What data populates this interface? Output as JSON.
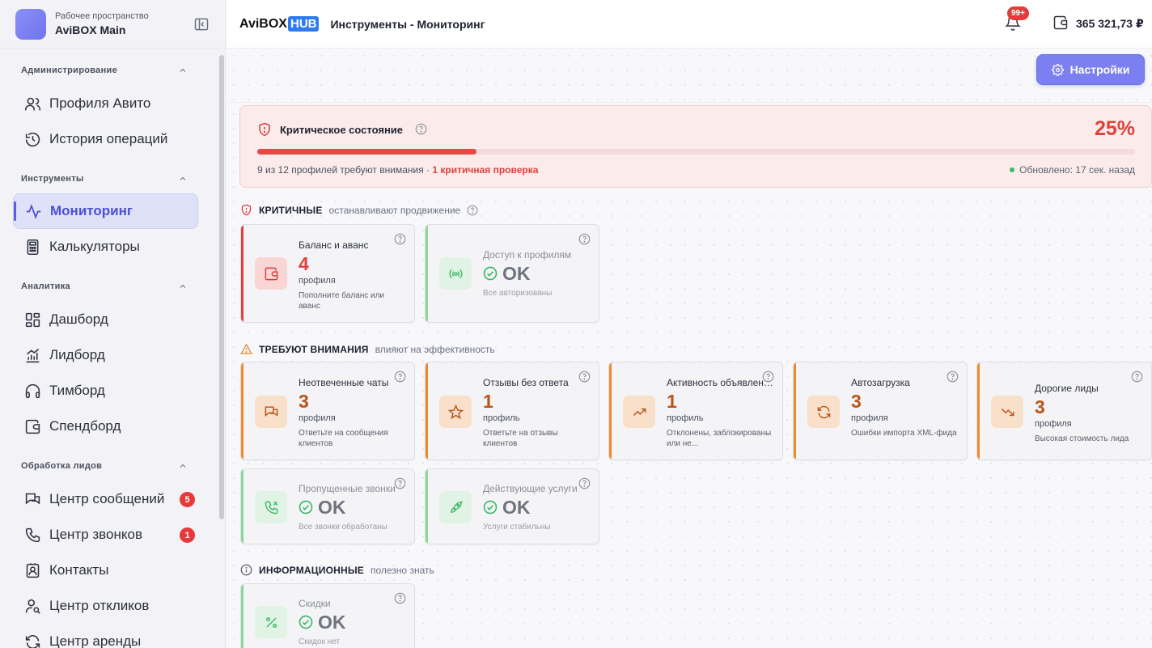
{
  "workspace": {
    "subtitle": "Рабочее пространство",
    "name": "AviBOX Main"
  },
  "sidebar": {
    "sections": [
      {
        "label": "Администрирование",
        "items": [
          {
            "label": "Профиля Авито",
            "icon": "users-icon"
          },
          {
            "label": "История операций",
            "icon": "history-icon"
          }
        ]
      },
      {
        "label": "Инструменты",
        "items": [
          {
            "label": "Мониторинг",
            "icon": "activity-icon",
            "active": true
          },
          {
            "label": "Калькуляторы",
            "icon": "calculator-icon"
          }
        ]
      },
      {
        "label": "Аналитика",
        "items": [
          {
            "label": "Дашборд",
            "icon": "dashboard-icon"
          },
          {
            "label": "Лидборд",
            "icon": "bar-chart-icon"
          },
          {
            "label": "Тимборд",
            "icon": "headphones-icon"
          },
          {
            "label": "Спендборд",
            "icon": "wallet-icon"
          }
        ]
      },
      {
        "label": "Обработка лидов",
        "items": [
          {
            "label": "Центр сообщений",
            "icon": "messages-icon",
            "badge": "5"
          },
          {
            "label": "Центр звонков",
            "icon": "phone-icon",
            "badge": "1"
          },
          {
            "label": "Контакты",
            "icon": "contacts-icon"
          },
          {
            "label": "Центр откликов",
            "icon": "user-search-icon"
          },
          {
            "label": "Центр аренды",
            "icon": "refresh-icon"
          }
        ]
      }
    ]
  },
  "header": {
    "brand_main": "AviBOX",
    "brand_hub": "HUB",
    "title": "Инструменты - Мониторинг",
    "notifications": "99+",
    "balance": "365 321,73 ₽"
  },
  "toolbar": {
    "settings_label": "Настройки"
  },
  "critical_banner": {
    "title": "Критическое состояние",
    "percent": "25%",
    "progress": 0.25,
    "note": "9 из 12 профилей требуют внимания · ",
    "note_highlight": "1 критичная проверка",
    "updated": "Обновлено: 17 сек. назад"
  },
  "categories": {
    "critical": {
      "title": "КРИТИЧНЫЕ",
      "subtitle": "останавливают продвижение"
    },
    "attention": {
      "title": "ТРЕБУЮТ ВНИМАНИЯ",
      "subtitle": "влияют на эффективность"
    },
    "info": {
      "title": "ИНФОРМАЦИОННЫЕ",
      "subtitle": "полезно знать"
    }
  },
  "cards": {
    "balance": {
      "title": "Баланс и аванс",
      "value": "4",
      "unit": "профиля",
      "desc": "Пополните баланс или аванс"
    },
    "access": {
      "title": "Доступ к профилям",
      "ok": "OK",
      "desc": "Все авторизованы"
    },
    "unanswered": {
      "title": "Неотвеченные чаты",
      "value": "3",
      "unit": "профиля",
      "desc": "Ответьте на сообщения клиентов"
    },
    "reviews": {
      "title": "Отзывы без ответа",
      "value": "1",
      "unit": "профиль",
      "desc": "Ответьте на отзывы клиентов"
    },
    "activity": {
      "title": "Активность объявлений",
      "value": "1",
      "unit": "профиль",
      "desc": "Отклонены, заблокированы или не..."
    },
    "autoload": {
      "title": "Автозагрузка",
      "value": "3",
      "unit": "профиля",
      "desc": "Ошибки импорта XML-фида"
    },
    "expensive": {
      "title": "Дорогие лиды",
      "value": "3",
      "unit": "профиля",
      "desc": "Высокая стоимость лида"
    },
    "missed": {
      "title": "Пропущенные звонки",
      "ok": "OK",
      "desc": "Все звонки обработаны"
    },
    "services": {
      "title": "Действующие услуги",
      "ok": "OK",
      "desc": "Услуги стабильны"
    },
    "discounts": {
      "title": "Скидки",
      "ok": "OK",
      "desc": "Скидок нет"
    }
  },
  "colors": {
    "accent": "#5a5ee8",
    "critical": "#e2403c",
    "warning": "#ef8a2c",
    "ok": "#3fb86a"
  }
}
